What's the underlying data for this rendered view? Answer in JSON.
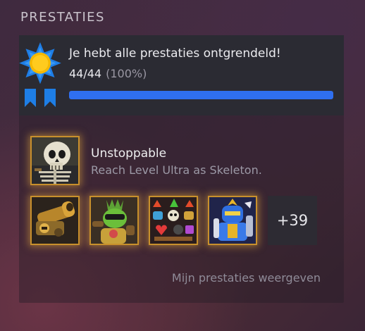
{
  "section": {
    "title": "PRESTATIES"
  },
  "summary": {
    "title": "Je hebt alle prestaties ontgrendeld!",
    "count": "44/44",
    "percent": "(100%)",
    "progress": 1.0
  },
  "featured": {
    "name": "Unstoppable",
    "description": "Reach Level Ultra as Skeleton.",
    "icon": "skeleton-icon"
  },
  "icons": [
    "cannon-icon",
    "green-warrior-icon",
    "item-collection-icon",
    "armored-knight-icon"
  ],
  "more": {
    "label": "+39"
  },
  "footer": {
    "link_label": "Mijn prestaties weergeven"
  },
  "colors": {
    "accent_blue": "#2f6ff0",
    "gold_glow": "#e6aa3c",
    "medal_blue": "#1e7ee6",
    "medal_sun": "#f5b800"
  }
}
